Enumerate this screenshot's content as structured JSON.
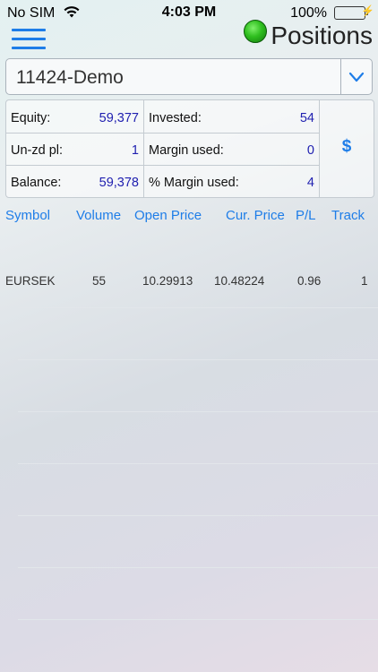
{
  "status_bar": {
    "carrier": "No SIM",
    "time": "4:03 PM",
    "battery": "100%",
    "battery_level": 1.0
  },
  "header": {
    "title": "Positions",
    "connection_status_color": "#2fbf1f",
    "menu_icon": "hamburger-menu-icon"
  },
  "account": {
    "selected": "11424-Demo"
  },
  "summary": {
    "equity_label": "Equity:",
    "equity_value": "59,377",
    "invested_label": "Invested:",
    "invested_value": "54",
    "unzd_label": "Un-zd pl:",
    "unzd_value": "1",
    "margin_used_label": "Margin used:",
    "margin_used_value": "0",
    "balance_label": "Balance:",
    "balance_value": "59,378",
    "pct_margin_label": "% Margin used:",
    "pct_margin_value": "4",
    "currency_button": "$"
  },
  "table": {
    "headers": [
      "Symbol",
      "Volume",
      "Open Price",
      "Cur. Price",
      "P/L",
      "Track"
    ],
    "rows": [
      [
        "EURSEK",
        "55",
        "10.29913",
        "10.48224",
        "0.96",
        "1"
      ]
    ]
  },
  "colors": {
    "accent": "#1e7de8",
    "value_text": "#2020b0"
  }
}
